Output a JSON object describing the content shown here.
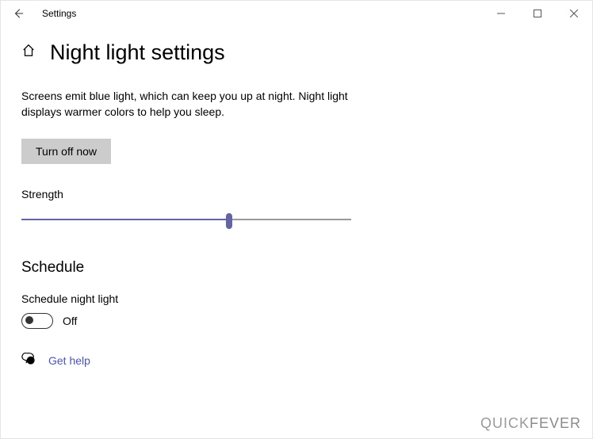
{
  "window": {
    "title": "Settings"
  },
  "page": {
    "heading": "Night light settings",
    "description": "Screens emit blue light, which can keep you up at night. Night light displays warmer colors to help you sleep.",
    "turn_off_label": "Turn off now"
  },
  "slider": {
    "label": "Strength",
    "percent": 63
  },
  "schedule": {
    "heading": "Schedule",
    "label": "Schedule night light",
    "state": "Off",
    "on": false
  },
  "help": {
    "label": "Get help"
  },
  "watermark": {
    "part1": "QUICK",
    "part2": "FEVER"
  },
  "colors": {
    "accent": "#6264a7"
  }
}
